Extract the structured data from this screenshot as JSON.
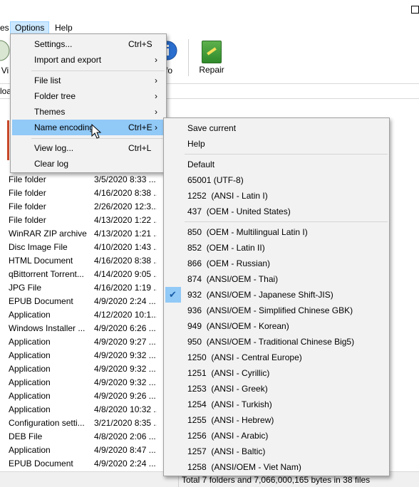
{
  "menubar": {
    "items": [
      {
        "label": "es"
      },
      {
        "label": "Options"
      },
      {
        "label": "Help"
      }
    ]
  },
  "toolbar": {
    "view_label": "Vi",
    "info_label": "fo",
    "repair_label": "Repair"
  },
  "address": {
    "text": "loa"
  },
  "options_menu": {
    "items": [
      {
        "label": "Settings...",
        "shortcut": "Ctrl+S",
        "arrow": ""
      },
      {
        "label": "Import and export",
        "shortcut": "",
        "arrow": "›"
      },
      {
        "label": "File list",
        "shortcut": "",
        "arrow": "›"
      },
      {
        "label": "Folder tree",
        "shortcut": "",
        "arrow": "›"
      },
      {
        "label": "Themes",
        "shortcut": "",
        "arrow": "›"
      },
      {
        "label": "Name encoding",
        "shortcut": "Ctrl+E",
        "arrow": "›"
      },
      {
        "label": "View log...",
        "shortcut": "Ctrl+L",
        "arrow": ""
      },
      {
        "label": "Clear log",
        "shortcut": "",
        "arrow": ""
      }
    ]
  },
  "encoding_menu": {
    "items": [
      {
        "label": "Save current"
      },
      {
        "label": "Help"
      },
      {
        "label": "Default"
      },
      {
        "label": "65001 (UTF-8)"
      },
      {
        "label": "1252  (ANSI - Latin I)"
      },
      {
        "label": "437  (OEM - United States)"
      },
      {
        "label": "850  (OEM - Multilingual Latin I)"
      },
      {
        "label": "852  (OEM - Latin II)"
      },
      {
        "label": "866  (OEM - Russian)"
      },
      {
        "label": "874  (ANSI/OEM - Thai)"
      },
      {
        "label": "932  (ANSI/OEM - Japanese Shift-JIS)",
        "checked": true
      },
      {
        "label": "936  (ANSI/OEM - Simplified Chinese GBK)"
      },
      {
        "label": "949  (ANSI/OEM - Korean)"
      },
      {
        "label": "950  (ANSI/OEM - Traditional Chinese Big5)"
      },
      {
        "label": "1250  (ANSI - Central Europe)"
      },
      {
        "label": "1251  (ANSI - Cyrillic)"
      },
      {
        "label": "1253  (ANSI - Greek)"
      },
      {
        "label": "1254  (ANSI - Turkish)"
      },
      {
        "label": "1255  (ANSI - Hebrew)"
      },
      {
        "label": "1256  (ANSI - Arabic)"
      },
      {
        "label": "1257  (ANSI - Baltic)"
      },
      {
        "label": "1258  (ANSI/OEM - Viet Nam)"
      }
    ],
    "check_glyph": "✔"
  },
  "file_list": {
    "rows": [
      {
        "type": "File folder",
        "date": "3/5/2020 8:33 ..."
      },
      {
        "type": "File folder",
        "date": "4/16/2020 8:38 ..."
      },
      {
        "type": "File folder",
        "date": "2/26/2020 12:3..."
      },
      {
        "type": "File folder",
        "date": "4/13/2020 1:22 ..."
      },
      {
        "type": "WinRAR ZIP archive",
        "date": "4/13/2020 1:21 ..."
      },
      {
        "type": "Disc Image File",
        "date": "4/10/2020 1:43 ..."
      },
      {
        "type": "HTML Document",
        "date": "4/16/2020 8:38 ..."
      },
      {
        "type": "qBittorrent Torrent...",
        "date": "4/14/2020 9:05 ..."
      },
      {
        "type": "JPG File",
        "date": "4/16/2020 1:19 ..."
      },
      {
        "type": "EPUB Document",
        "date": "4/9/2020 2:24 ..."
      },
      {
        "type": "Application",
        "date": "4/12/2020 10:1..."
      },
      {
        "type": "Windows Installer ...",
        "date": "4/9/2020 6:26 ..."
      },
      {
        "type": "Application",
        "date": "4/9/2020 9:27 ..."
      },
      {
        "type": "Application",
        "date": "4/9/2020 9:32 ..."
      },
      {
        "type": "Application",
        "date": "4/9/2020 9:32 ..."
      },
      {
        "type": "Application",
        "date": "4/9/2020 9:32 ..."
      },
      {
        "type": "Application",
        "date": "4/9/2020 9:26 ..."
      },
      {
        "type": "Application",
        "date": "4/8/2020 10:32 ..."
      },
      {
        "type": "Configuration setti...",
        "date": "3/21/2020 8:35 ..."
      },
      {
        "type": "DEB File",
        "date": "4/8/2020 2:06 ..."
      },
      {
        "type": "Application",
        "date": "4/9/2020 8:47 ..."
      },
      {
        "type": "EPUB Document",
        "date": "4/9/2020 2:24 ..."
      }
    ]
  },
  "status": {
    "text": "Total 7 folders and 7,066,000,165 bytes in 38 files"
  }
}
